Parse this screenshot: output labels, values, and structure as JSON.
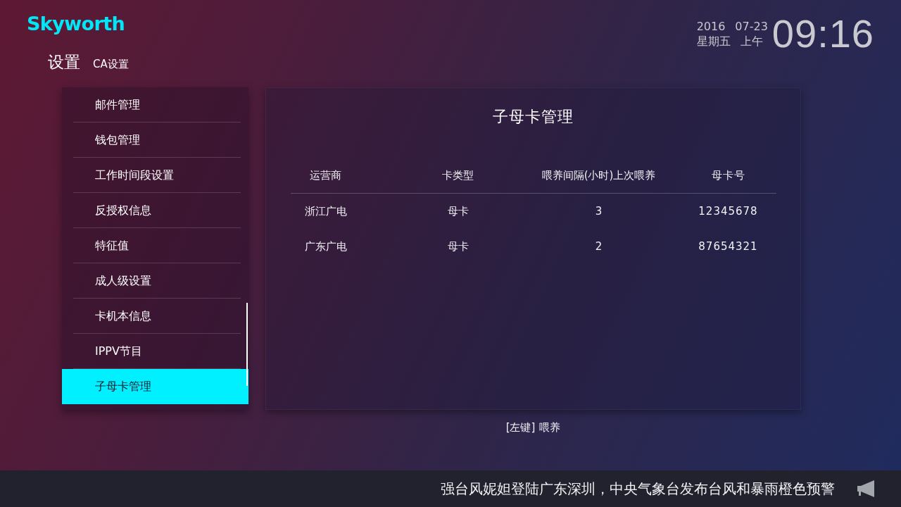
{
  "logo": {
    "text": "Skyworth"
  },
  "breadcrumb": {
    "title": "设置",
    "subtitle": "CA设置"
  },
  "clock": {
    "year": "2016",
    "date": "07-23",
    "weekday": "星期五",
    "period": "上午",
    "time": "09:16"
  },
  "sidebar": {
    "items": [
      {
        "label": "邮件管理",
        "selected": false
      },
      {
        "label": "钱包管理",
        "selected": false
      },
      {
        "label": "工作时间段设置",
        "selected": false
      },
      {
        "label": "反授权信息",
        "selected": false
      },
      {
        "label": "特征值",
        "selected": false
      },
      {
        "label": "成人级设置",
        "selected": false
      },
      {
        "label": "卡机本信息",
        "selected": false
      },
      {
        "label": "IPPV节目",
        "selected": false
      },
      {
        "label": "子母卡管理",
        "selected": true
      }
    ]
  },
  "panel": {
    "title": "子母卡管理",
    "table": {
      "columns": [
        "运营商",
        "卡类型",
        "喂养间隔(小时)上次喂养",
        "母卡号"
      ],
      "rows": [
        {
          "cells": [
            "浙江广电",
            "母卡",
            "3",
            "12345678"
          ]
        },
        {
          "cells": [
            "广东广电",
            "母卡",
            "2",
            "87654321"
          ]
        }
      ]
    }
  },
  "hint": {
    "key": "[左键]",
    "action": "喂养"
  },
  "ticker": {
    "text": "强台风妮妲登陆广东深圳，中央气象台发布台风和暴雨橙色预警"
  }
}
